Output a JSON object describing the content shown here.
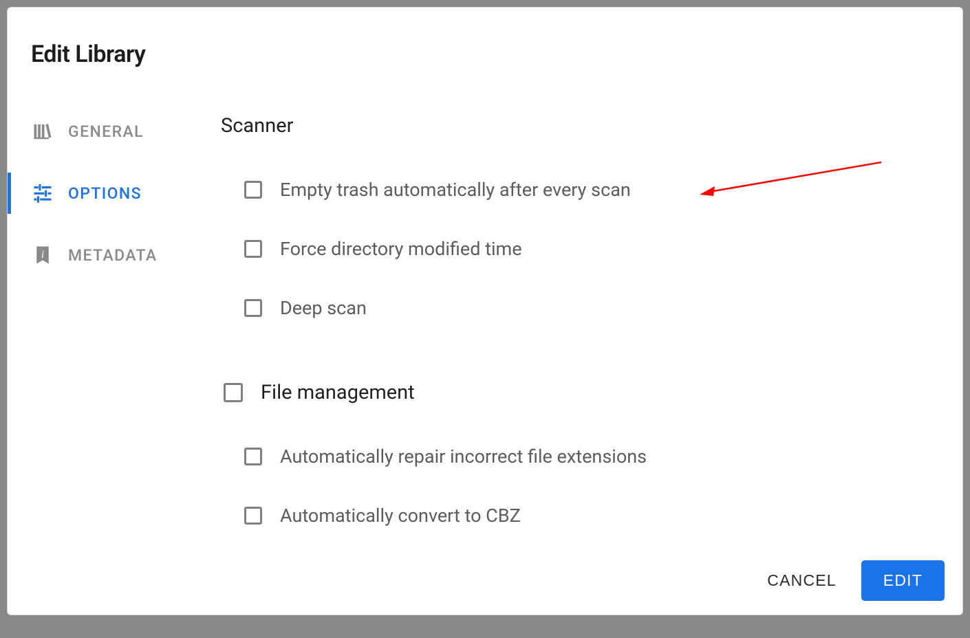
{
  "dialog": {
    "title": "Edit Library"
  },
  "sidebar": {
    "items": [
      {
        "label": "GENERAL",
        "icon": "library-icon",
        "active": false
      },
      {
        "label": "OPTIONS",
        "icon": "sliders-icon",
        "active": true
      },
      {
        "label": "METADATA",
        "icon": "bookmark-info-icon",
        "active": false
      }
    ]
  },
  "sections": {
    "scanner": {
      "heading": "Scanner",
      "options": [
        {
          "label": "Empty trash automatically after every scan",
          "checked": false
        },
        {
          "label": "Force directory modified time",
          "checked": false
        },
        {
          "label": "Deep scan",
          "checked": false
        }
      ]
    },
    "file_management": {
      "heading": "File management",
      "heading_checked": false,
      "options": [
        {
          "label": "Automatically repair incorrect file extensions",
          "checked": false
        },
        {
          "label": "Automatically convert to CBZ",
          "checked": false
        }
      ]
    }
  },
  "actions": {
    "cancel": "CANCEL",
    "edit": "EDIT"
  },
  "colors": {
    "accent": "#1a73e8",
    "text": "#202020",
    "muted": "#5c5c5c",
    "sidebar_muted": "#8a8a8a"
  }
}
